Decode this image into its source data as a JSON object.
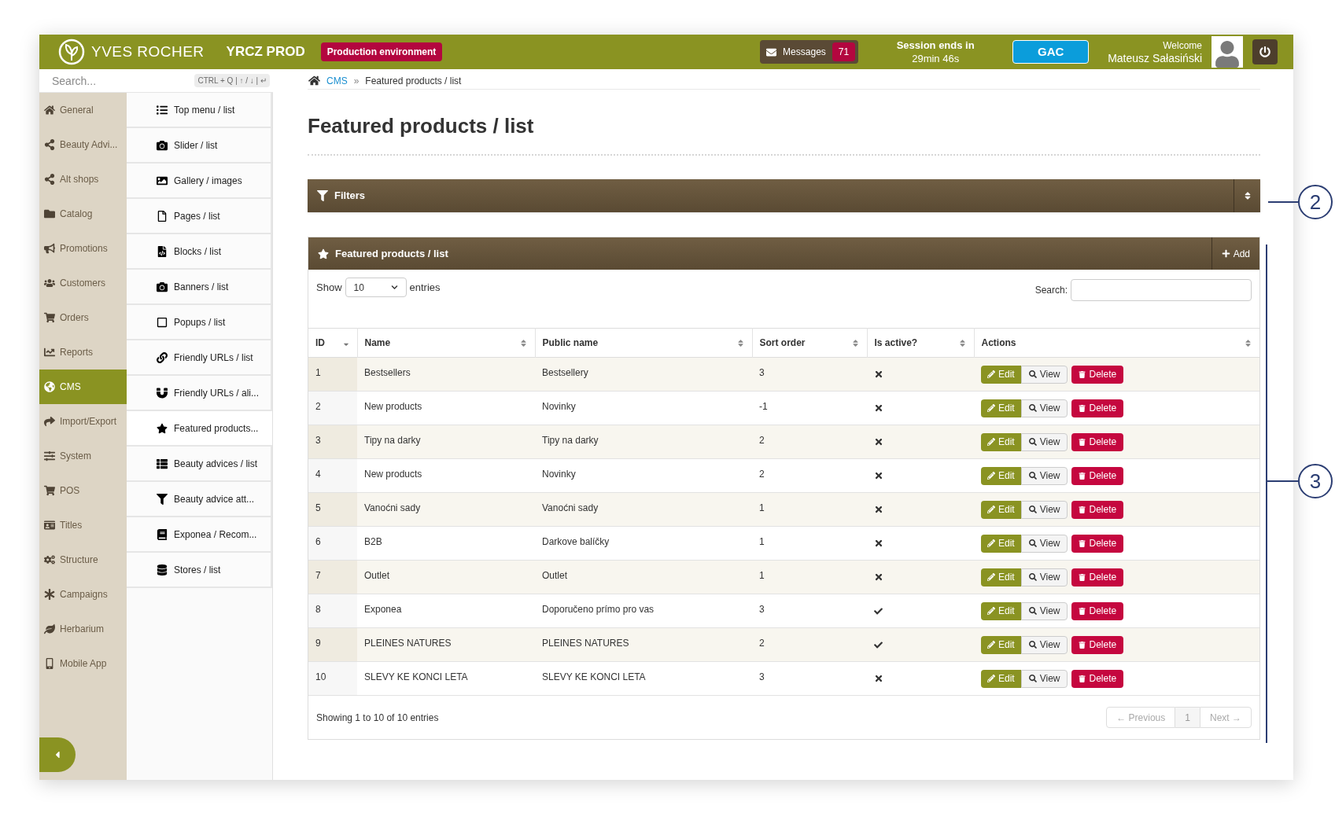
{
  "header": {
    "brand": "YVES ROCHER",
    "environment_name": "YRCZ PROD",
    "environment_badge": "Production environment",
    "messages": {
      "label": "Messages",
      "count": "71"
    },
    "session": {
      "label": "Session ends in",
      "time": "29min 46s"
    },
    "store_button": "GAC",
    "welcome": "Welcome",
    "user": "Mateusz Sałasiński"
  },
  "sidebar": {
    "search": {
      "placeholder": "Search...",
      "shortcut": "CTRL + Q | ↑ / ↓ | ↵"
    },
    "items": [
      {
        "label": "General",
        "selected": false
      },
      {
        "label": "Beauty Advi...",
        "selected": false
      },
      {
        "label": "Alt shops",
        "selected": false
      },
      {
        "label": "Catalog",
        "selected": false
      },
      {
        "label": "Promotions",
        "selected": false
      },
      {
        "label": "Customers",
        "selected": false
      },
      {
        "label": "Orders",
        "selected": false
      },
      {
        "label": "Reports",
        "selected": false
      },
      {
        "label": "CMS",
        "selected": true
      },
      {
        "label": "Import/Export",
        "selected": false
      },
      {
        "label": "System",
        "selected": false
      },
      {
        "label": "POS",
        "selected": false
      },
      {
        "label": "Titles",
        "selected": false
      },
      {
        "label": "Structure",
        "selected": false
      },
      {
        "label": "Campaigns",
        "selected": false
      },
      {
        "label": "Herbarium",
        "selected": false
      },
      {
        "label": "Mobile App",
        "selected": false
      }
    ],
    "subitems": [
      {
        "label": "Top menu / list",
        "selected": false
      },
      {
        "label": "Slider / list",
        "selected": false
      },
      {
        "label": "Gallery / images",
        "selected": false
      },
      {
        "label": "Pages / list",
        "selected": false
      },
      {
        "label": "Blocks / list",
        "selected": false
      },
      {
        "label": "Banners / list",
        "selected": false
      },
      {
        "label": "Popups / list",
        "selected": false
      },
      {
        "label": "Friendly URLs / list",
        "selected": false
      },
      {
        "label": "Friendly URLs / ali...",
        "selected": false
      },
      {
        "label": "Featured products...",
        "selected": true
      },
      {
        "label": "Beauty advices / list",
        "selected": false
      },
      {
        "label": "Beauty advice att...",
        "selected": false
      },
      {
        "label": "Exponea / Recom...",
        "selected": false
      },
      {
        "label": "Stores / list",
        "selected": false
      }
    ]
  },
  "breadcrumb": {
    "items": [
      "CMS",
      "Featured products / list"
    ],
    "separator": "»"
  },
  "page_title": "Featured products / list",
  "filters": {
    "title": "Filters"
  },
  "list": {
    "title": "Featured products / list",
    "add_button": "Add",
    "show_label": "Show",
    "page_size": "10",
    "entries_label": "entries",
    "search_label": "Search:",
    "columns": [
      {
        "label": "ID",
        "sorted_desc": true
      },
      {
        "label": "Name",
        "sorted_desc": false
      },
      {
        "label": "Public name",
        "sorted_desc": false
      },
      {
        "label": "Sort order",
        "sorted_desc": false
      },
      {
        "label": "Is active?",
        "sorted_desc": false
      },
      {
        "label": "Actions",
        "sorted_desc": false
      }
    ],
    "rows": [
      {
        "id": "1",
        "name": "Bestsellers",
        "public_name": "Bestsellery",
        "sort_order": "3",
        "active": false,
        "actions": [
          "Edit",
          "View",
          "Delete"
        ]
      },
      {
        "id": "2",
        "name": "New products",
        "public_name": "Novinky",
        "sort_order": "-1",
        "active": false,
        "actions": [
          "Edit",
          "View",
          "Delete"
        ]
      },
      {
        "id": "3",
        "name": "Tipy na darky",
        "public_name": "Tipy na darky",
        "sort_order": "2",
        "active": false,
        "actions": [
          "Edit",
          "View",
          "Delete"
        ]
      },
      {
        "id": "4",
        "name": "New products",
        "public_name": "Novinky",
        "sort_order": "2",
        "active": false,
        "actions": [
          "Edit",
          "View",
          "Delete"
        ]
      },
      {
        "id": "5",
        "name": "Vanoćni sady",
        "public_name": "Vanoćni sady",
        "sort_order": "1",
        "active": false,
        "actions": [
          "Edit",
          "View",
          "Delete"
        ]
      },
      {
        "id": "6",
        "name": "B2B",
        "public_name": "Darkove balíčky",
        "sort_order": "1",
        "active": false,
        "actions": [
          "Edit",
          "View",
          "Delete"
        ]
      },
      {
        "id": "7",
        "name": "Outlet",
        "public_name": "Outlet",
        "sort_order": "1",
        "active": false,
        "actions": [
          "Edit",
          "View",
          "Delete"
        ]
      },
      {
        "id": "8",
        "name": "Exponea",
        "public_name": "Doporučeno prímo pro vas",
        "sort_order": "3",
        "active": true,
        "actions": [
          "Edit",
          "View",
          "Delete"
        ]
      },
      {
        "id": "9",
        "name": "PLEINES NATURES",
        "public_name": "PLEINES NATURES",
        "sort_order": "2",
        "active": true,
        "actions": [
          "Edit",
          "View",
          "Delete"
        ]
      },
      {
        "id": "10",
        "name": "SLEVY KE KONCI LETA",
        "public_name": "SLEVY KE KONCI LETA",
        "sort_order": "3",
        "active": false,
        "actions": [
          "Edit",
          "View",
          "Delete"
        ]
      }
    ],
    "info": "Showing 1 to 10 of 10 entries",
    "pagination": {
      "previous": {
        "label": "← Previous",
        "disabled": true
      },
      "pages": [
        {
          "label": "1",
          "selected": true
        }
      ],
      "next": {
        "label": "Next →",
        "disabled": true
      }
    }
  },
  "annotations": [
    {
      "label": "2"
    },
    {
      "label": "3"
    }
  ]
}
